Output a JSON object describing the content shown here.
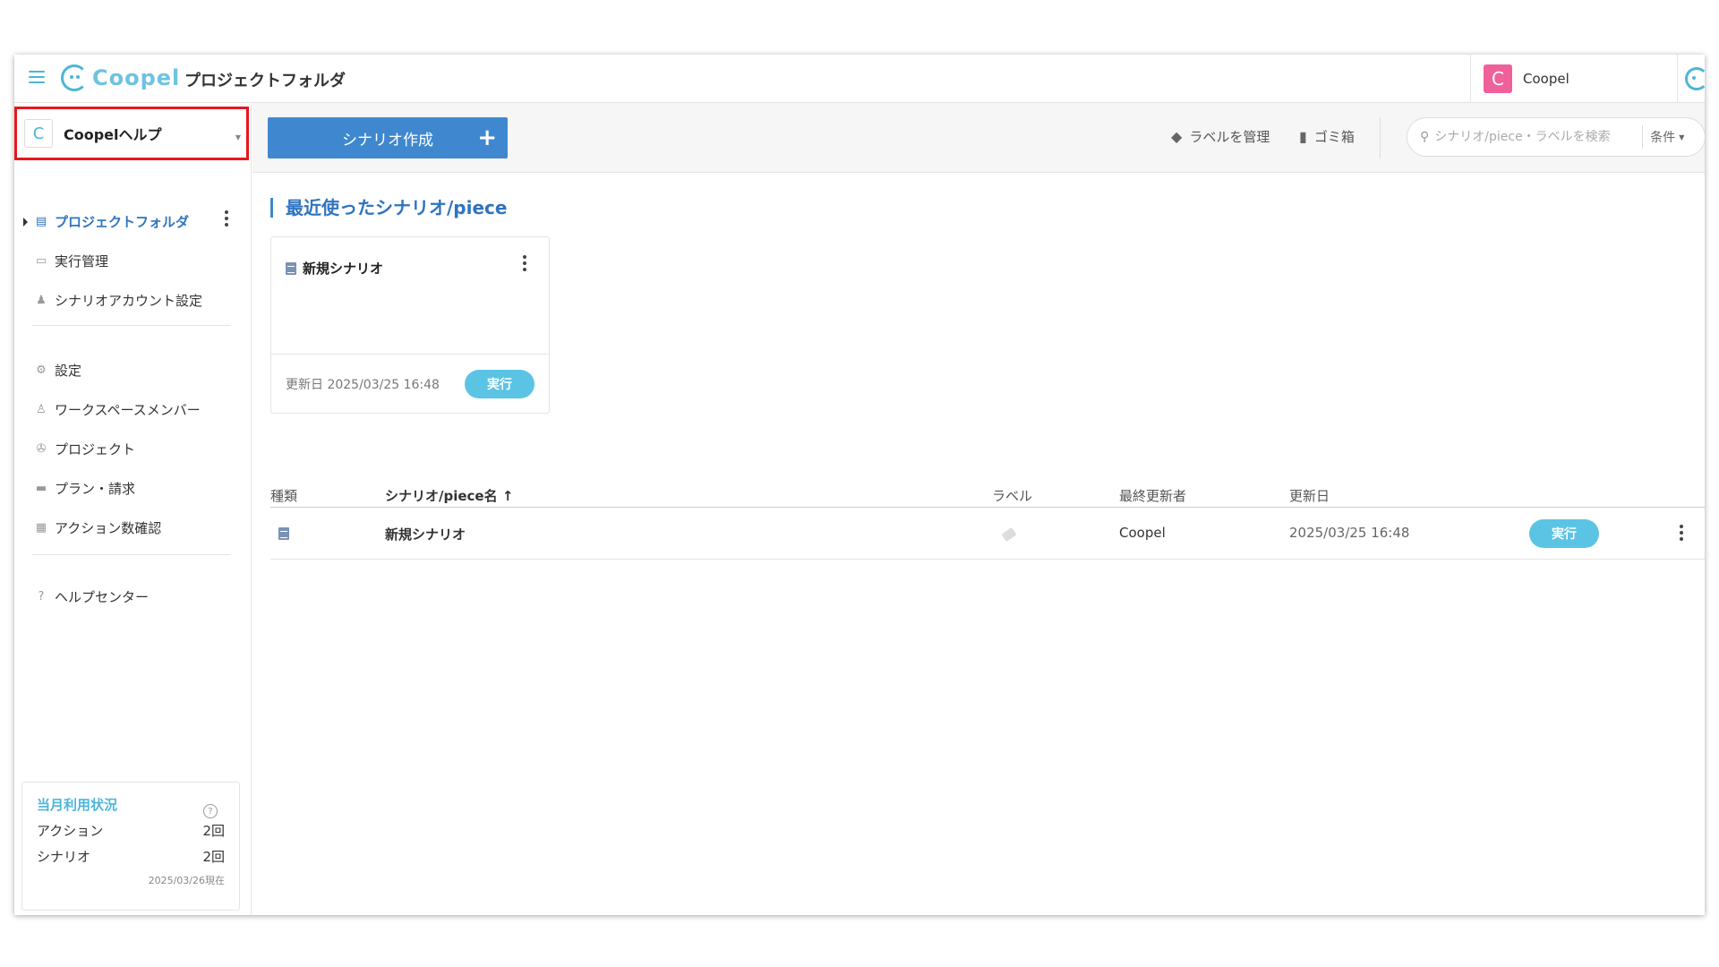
{
  "header": {
    "logo_text": "Coopel",
    "title": "プロジェクトフォルダ",
    "user_avatar_letter": "C",
    "user_name": "Coopel"
  },
  "workspace": {
    "icon_letter": "C",
    "name": "Coopelヘルプ"
  },
  "sidebar": {
    "items": [
      {
        "label": "プロジェクトフォルダ",
        "icon": "folder-icon",
        "active": true
      },
      {
        "label": "実行管理",
        "icon": "calendar-icon"
      },
      {
        "label": "シナリオアカウント設定",
        "icon": "account-lock-icon"
      },
      {
        "label": "設定",
        "icon": "gear-icon"
      },
      {
        "label": "ワークスペースメンバー",
        "icon": "members-icon"
      },
      {
        "label": "プロジェクト",
        "icon": "project-icon"
      },
      {
        "label": "プラン・請求",
        "icon": "card-icon"
      },
      {
        "label": "アクション数確認",
        "icon": "counter-icon"
      },
      {
        "label": "ヘルプセンター",
        "icon": "help-icon"
      }
    ],
    "usage": {
      "title": "当月利用状況",
      "rows": [
        {
          "label": "アクション",
          "value": "2回"
        },
        {
          "label": "シナリオ",
          "value": "2回"
        }
      ],
      "as_of": "2025/03/26現在"
    }
  },
  "toolbar": {
    "create_label": "シナリオ作成",
    "manage_labels": "ラベルを管理",
    "trash": "ゴミ箱",
    "search_placeholder": "シナリオ/piece・ラベルを検索",
    "conditions": "条件"
  },
  "recent": {
    "title": "最近使ったシナリオ/piece",
    "card": {
      "name": "新規シナリオ",
      "updated": "更新日 2025/03/25 16:48",
      "run_label": "実行"
    }
  },
  "table": {
    "headers": {
      "type": "種類",
      "name": "シナリオ/piece名 ↑",
      "label": "ラベル",
      "updater": "最終更新者",
      "updated": "更新日"
    },
    "rows": [
      {
        "name": "新規シナリオ",
        "updater": "Coopel",
        "updated": "2025/03/25 16:48",
        "run_label": "実行"
      }
    ]
  },
  "colors": {
    "accent": "#3f88cf",
    "run": "#5bc4e5",
    "highlight": "#e8161e",
    "avatar": "#f0609a"
  }
}
